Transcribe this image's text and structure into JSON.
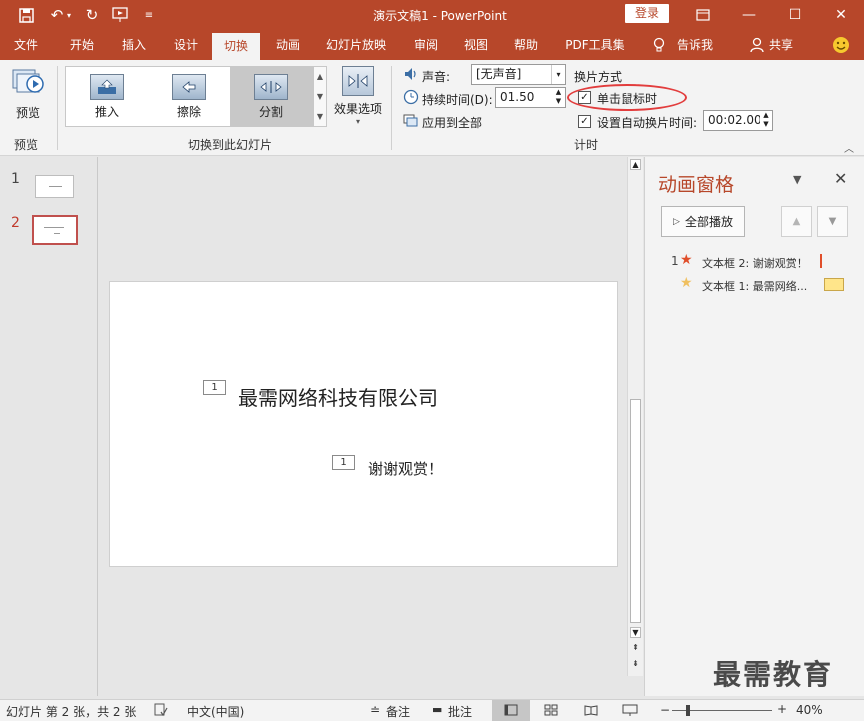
{
  "titlebar": {
    "doc_title": "演示文稿1  -  PowerPoint",
    "login_label": "登录",
    "accent": "#b7472a"
  },
  "tabs": [
    {
      "label": "文件"
    },
    {
      "label": "开始"
    },
    {
      "label": "插入"
    },
    {
      "label": "设计"
    },
    {
      "label": "切换",
      "active": true
    },
    {
      "label": "动画"
    },
    {
      "label": "幻灯片放映"
    },
    {
      "label": "审阅"
    },
    {
      "label": "视图"
    },
    {
      "label": "帮助"
    },
    {
      "label": "PDF工具集"
    },
    {
      "label": "告诉我"
    },
    {
      "label": "共享"
    }
  ],
  "ribbon": {
    "preview_label": "预览",
    "preview_group_label": "预览",
    "gallery_items": [
      {
        "label": "推入",
        "icon": "push-icon"
      },
      {
        "label": "擦除",
        "icon": "wipe-icon"
      },
      {
        "label": "分割",
        "icon": "split-icon",
        "selected": true
      }
    ],
    "effect_options_label": "效果选项",
    "transition_group_label": "切换到此幻灯片",
    "sound_label": "声音:",
    "sound_value": "[无声音]",
    "duration_label": "持续时间(D):",
    "duration_value": "01.50",
    "apply_all_label": "应用到全部",
    "advance_heading": "换片方式",
    "on_click_label": "单击鼠标时",
    "on_click_checked": true,
    "auto_after_label": "设置自动换片时间:",
    "auto_after_checked": true,
    "auto_after_value": "00:02.00",
    "timing_group_label": "计时"
  },
  "thumbnails": [
    {
      "number": "1",
      "selected": false
    },
    {
      "number": "2",
      "selected": true
    }
  ],
  "slide": {
    "tag1": "1",
    "text1": "最需网络科技有限公司",
    "tag2": "1",
    "text2": "谢谢观赏！"
  },
  "anim_pane": {
    "title": "动画窗格",
    "play_all_label": "全部播放",
    "items": [
      {
        "index": "1",
        "label": "文本框 2: 谢谢观赏！"
      },
      {
        "index": "",
        "label": "文本框 1: 最需网络..."
      }
    ]
  },
  "statusbar": {
    "slide_info": "幻灯片 第 2 张，共 2 张",
    "language": "中文(中国)",
    "notes_label": "备注",
    "comments_label": "批注",
    "zoom": "40%"
  },
  "watermark": "最需教育"
}
